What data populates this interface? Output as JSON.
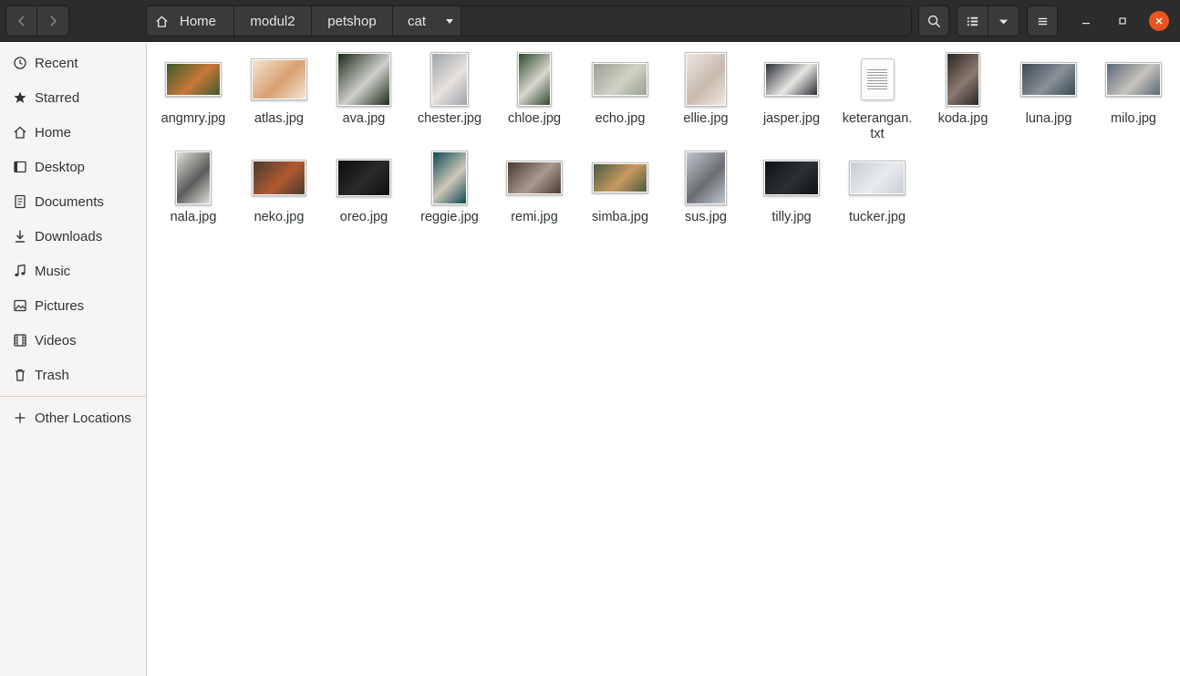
{
  "header": {
    "breadcrumbs": [
      "Home",
      "modul2",
      "petshop",
      "cat"
    ],
    "colors": {
      "bar": "#2c2c2c",
      "close": "#e95420"
    }
  },
  "sidebar": {
    "items": [
      {
        "label": "Recent",
        "icon": "clock-icon"
      },
      {
        "label": "Starred",
        "icon": "star-icon"
      },
      {
        "label": "Home",
        "icon": "home-icon"
      },
      {
        "label": "Desktop",
        "icon": "desktop-icon"
      },
      {
        "label": "Documents",
        "icon": "document-icon"
      },
      {
        "label": "Downloads",
        "icon": "download-icon"
      },
      {
        "label": "Music",
        "icon": "music-icon"
      },
      {
        "label": "Pictures",
        "icon": "picture-icon"
      },
      {
        "label": "Videos",
        "icon": "video-icon"
      },
      {
        "label": "Trash",
        "icon": "trash-icon"
      }
    ],
    "other_locations": {
      "label": "Other Locations",
      "icon": "plus-icon"
    }
  },
  "files": [
    {
      "name": "angmry.jpg",
      "colors": [
        "#3d5a2a",
        "#c8783a"
      ]
    },
    {
      "name": "atlas.jpg",
      "colors": [
        "#f1e4d2",
        "#d9a070"
      ]
    },
    {
      "name": "ava.jpg",
      "colors": [
        "#1c2a18",
        "#cfd0cc"
      ]
    },
    {
      "name": "chester.jpg",
      "colors": [
        "#9fa3ab",
        "#e7e3de"
      ]
    },
    {
      "name": "chloe.jpg",
      "colors": [
        "#2f4a2b",
        "#d8d6d0"
      ]
    },
    {
      "name": "echo.jpg",
      "colors": [
        "#9aa093",
        "#cfd3c6"
      ]
    },
    {
      "name": "ellie.jpg",
      "colors": [
        "#ede7e2",
        "#c9b9ad"
      ]
    },
    {
      "name": "jasper.jpg",
      "colors": [
        "#2b2f36",
        "#e9e7e4"
      ]
    },
    {
      "name": "keterangan.txt",
      "colors": []
    },
    {
      "name": "koda.jpg",
      "colors": [
        "#2a2624",
        "#8a7a70"
      ]
    },
    {
      "name": "luna.jpg",
      "colors": [
        "#3b4a52",
        "#8a9098"
      ]
    },
    {
      "name": "milo.jpg",
      "colors": [
        "#5a6878",
        "#c7c3bd"
      ]
    },
    {
      "name": "nala.jpg",
      "colors": [
        "#dfe0dc",
        "#5c5c5a"
      ]
    },
    {
      "name": "neko.jpg",
      "colors": [
        "#4a3a30",
        "#b05a30"
      ]
    },
    {
      "name": "oreo.jpg",
      "colors": [
        "#0d0d0d",
        "#2a2a2a"
      ]
    },
    {
      "name": "reggie.jpg",
      "colors": [
        "#0e4a52",
        "#cfc7ba"
      ]
    },
    {
      "name": "remi.jpg",
      "colors": [
        "#4a3a34",
        "#a89a90"
      ]
    },
    {
      "name": "simba.jpg",
      "colors": [
        "#4a5a40",
        "#c89a60"
      ]
    },
    {
      "name": "sus.jpg",
      "colors": [
        "#bfc6cc",
        "#6a6e72"
      ]
    },
    {
      "name": "tilly.jpg",
      "colors": [
        "#101214",
        "#2c3034"
      ]
    },
    {
      "name": "tucker.jpg",
      "colors": [
        "#c9ced4",
        "#e8ebee"
      ]
    }
  ]
}
